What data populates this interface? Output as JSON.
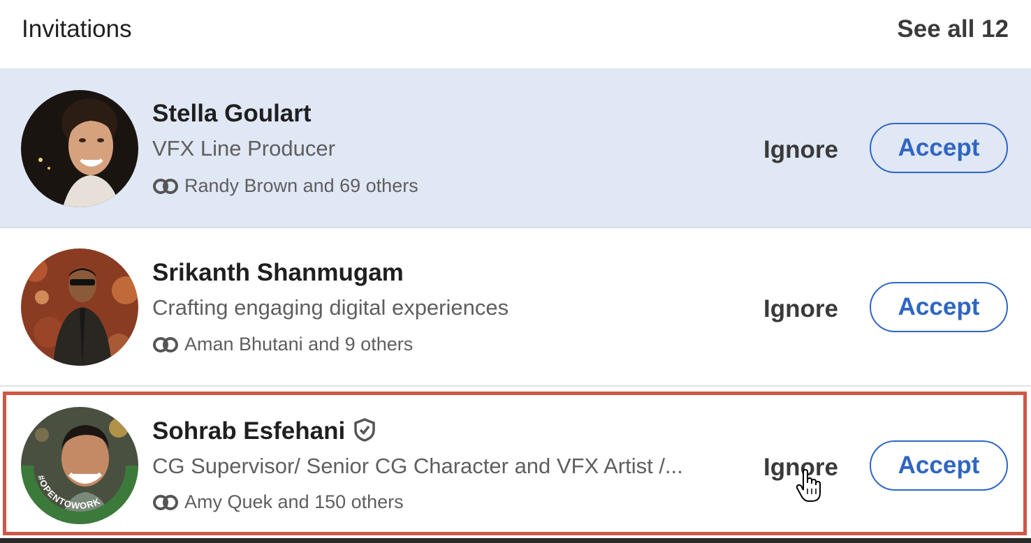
{
  "header": {
    "title": "Invitations",
    "see_all": "See all 12"
  },
  "invitations": [
    {
      "name": "Stella Goulart",
      "headline": "VFX Line Producer",
      "mutual": "Randy Brown and 69 others",
      "ignore_label": "Ignore",
      "accept_label": "Accept",
      "verified": false,
      "open_to_work": false
    },
    {
      "name": "Srikanth Shanmugam",
      "headline": "Crafting engaging digital experiences",
      "mutual": "Aman Bhutani and 9 others",
      "ignore_label": "Ignore",
      "accept_label": "Accept",
      "verified": false,
      "open_to_work": false
    },
    {
      "name": "Sohrab Esfehani",
      "headline": "CG Supervisor/ Senior CG Character and VFX Artist /...",
      "mutual": "Amy Quek and 150 others",
      "ignore_label": "Ignore",
      "accept_label": "Accept",
      "verified": true,
      "open_to_work": true,
      "badge_text": "#OPENTOWORK"
    }
  ],
  "colors": {
    "accent": "#2f66c2",
    "selected_row_bg": "#e0e7f5",
    "highlight_border": "#cf5747",
    "open_to_work_green": "#3b7a3a"
  },
  "icons": {
    "mutual": "mutual-connections-icon",
    "verified": "verified-shield-icon",
    "cursor": "hand-pointer-cursor-icon"
  }
}
